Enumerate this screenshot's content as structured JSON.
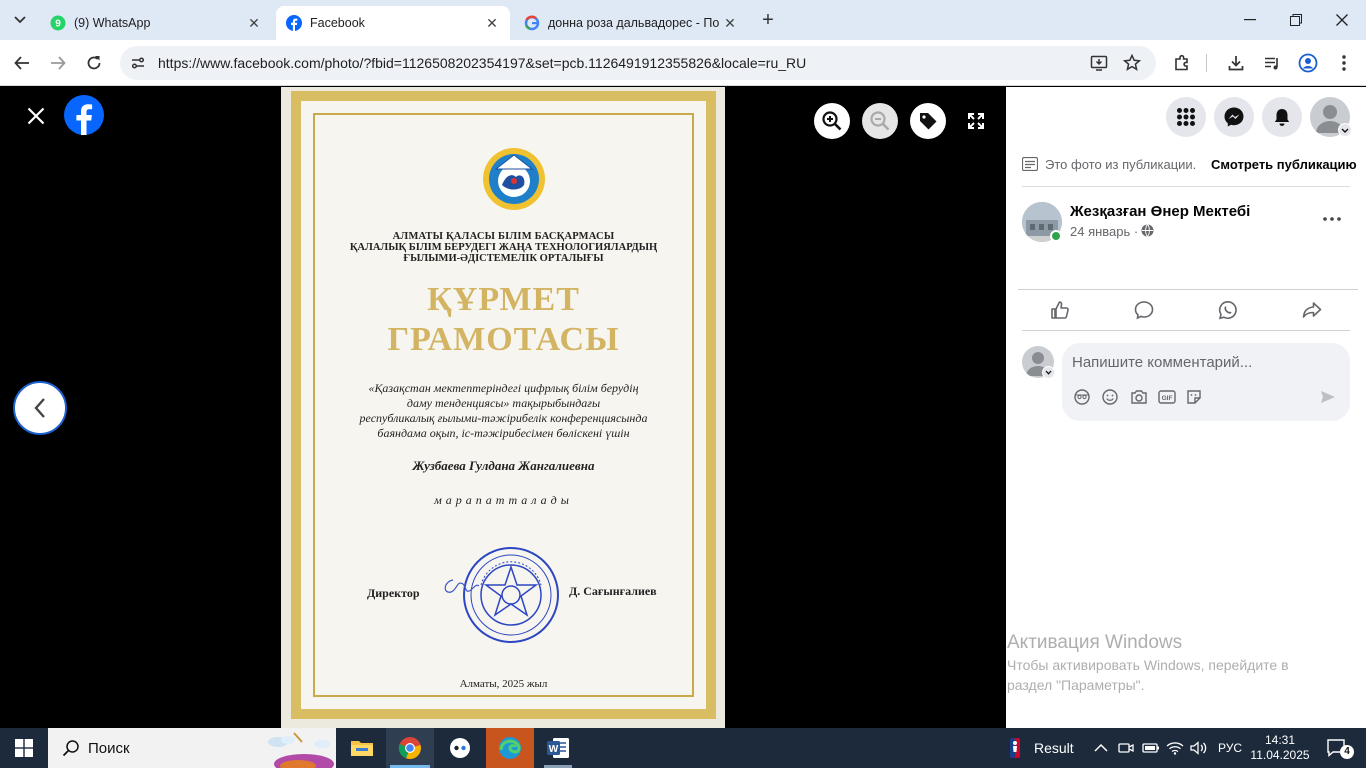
{
  "browser": {
    "tabs": [
      {
        "label": "(9) WhatsApp",
        "active": false,
        "favicon": "whatsapp-icon",
        "badge": "9"
      },
      {
        "label": "Facebook",
        "active": true,
        "favicon": "facebook-icon"
      },
      {
        "label": "донна роза дальвадорес - По",
        "active": false,
        "favicon": "google-icon"
      }
    ],
    "url": "https://www.facebook.com/photo/?fbid=1126508202354197&set=pcb.1126491912355826&locale=ru_RU"
  },
  "certificate": {
    "org_line1": "АЛМАТЫ ҚАЛАСЫ БІЛІМ БАСҚАРМАСЫ",
    "org_line2": "ҚАЛАЛЫҚ БІЛІМ БЕРУДЕГІ ЖАҢА ТЕХНОЛОГИЯЛАРДЫҢ",
    "org_line3": "ҒЫЛЫМИ-ӘДІСТЕМЕЛІК ОРТАЛЫҒЫ",
    "title1": "ҚҰРМЕТ",
    "title2": "ГРАМОТАСЫ",
    "body1": "«Қазақстан мектептеріндегі цифрлық білім берудің",
    "body2": "даму тенденциясы»  тақырыбындағы",
    "body3": "республикалық ғылыми-тәжірибелік конференциясында",
    "body4": "баяндама оқып,  іс-тәжірибесімен бөліскені үшін",
    "recipient": "Жузбаева Гулдана Жангалиевна",
    "awarded": "марапатталады",
    "director_label": "Директор",
    "director_name": "Д. Сағынғалиев",
    "footer": "Алматы, 2025 жыл"
  },
  "panel": {
    "post_notice": "Это фото из публикации.",
    "view_post": "Смотреть публикацию",
    "author": "Жезқазған Өнер Мектебі",
    "date": "24 январь ·",
    "comment_placeholder": "Напишите комментарий..."
  },
  "watermark": {
    "title": "Активация Windows",
    "line1": "Чтобы активировать Windows, перейдите в",
    "line2": "раздел \"Параметры\"."
  },
  "taskbar": {
    "search": "Поиск",
    "news": "Result",
    "lang": "РУС",
    "time": "14:31",
    "date": "11.04.2025",
    "notifications": "4"
  },
  "colors": {
    "tab_strip": "#dfe8f5",
    "facebook_blue": "#0866ff",
    "gold": "#d8bd63",
    "taskbar": "#1c2a3b"
  }
}
